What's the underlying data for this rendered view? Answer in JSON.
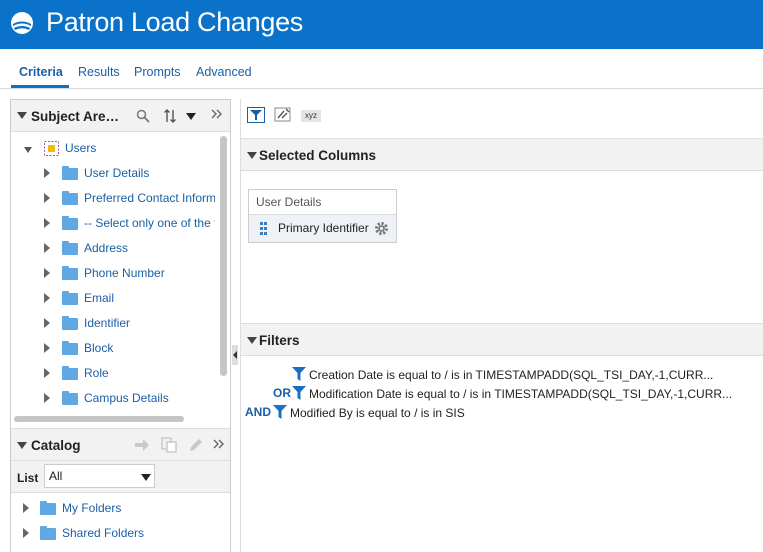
{
  "header": {
    "title": "Patron Load Changes",
    "logo_icon": "logo-icon",
    "bg_color": "#0a72c8"
  },
  "tabs": [
    {
      "label": "Criteria",
      "active": true
    },
    {
      "label": "Results"
    },
    {
      "label": "Prompts"
    },
    {
      "label": "Advanced"
    }
  ],
  "subject_areas": {
    "title": "Subject Are…",
    "root": "Users",
    "items": [
      "User Details",
      "Preferred Contact Information",
      "-- Select only one of the following",
      "Address",
      "Phone Number",
      "Email",
      "Identifier",
      "Block",
      "Role",
      "Campus Details"
    ]
  },
  "catalog": {
    "title": "Catalog",
    "list_label": "List",
    "list_value": "All",
    "folders": [
      "My Folders",
      "Shared Folders"
    ]
  },
  "selected_columns": {
    "title": "Selected Columns",
    "group": "User Details",
    "column": "Primary Identifier"
  },
  "filters": {
    "title": "Filters",
    "rows": [
      {
        "conj": "",
        "text": "Creation Date is equal to / is in  TIMESTAMPADD(SQL_TSI_DAY,-1,CURR..."
      },
      {
        "conj": "OR",
        "text": "Modification Date is equal to / is in  TIMESTAMPADD(SQL_TSI_DAY,-1,CURR..."
      },
      {
        "conj": "AND",
        "text": "Modified By is equal to / is in  SIS"
      }
    ]
  },
  "toolbar": {
    "xyz_label": "xyz"
  }
}
